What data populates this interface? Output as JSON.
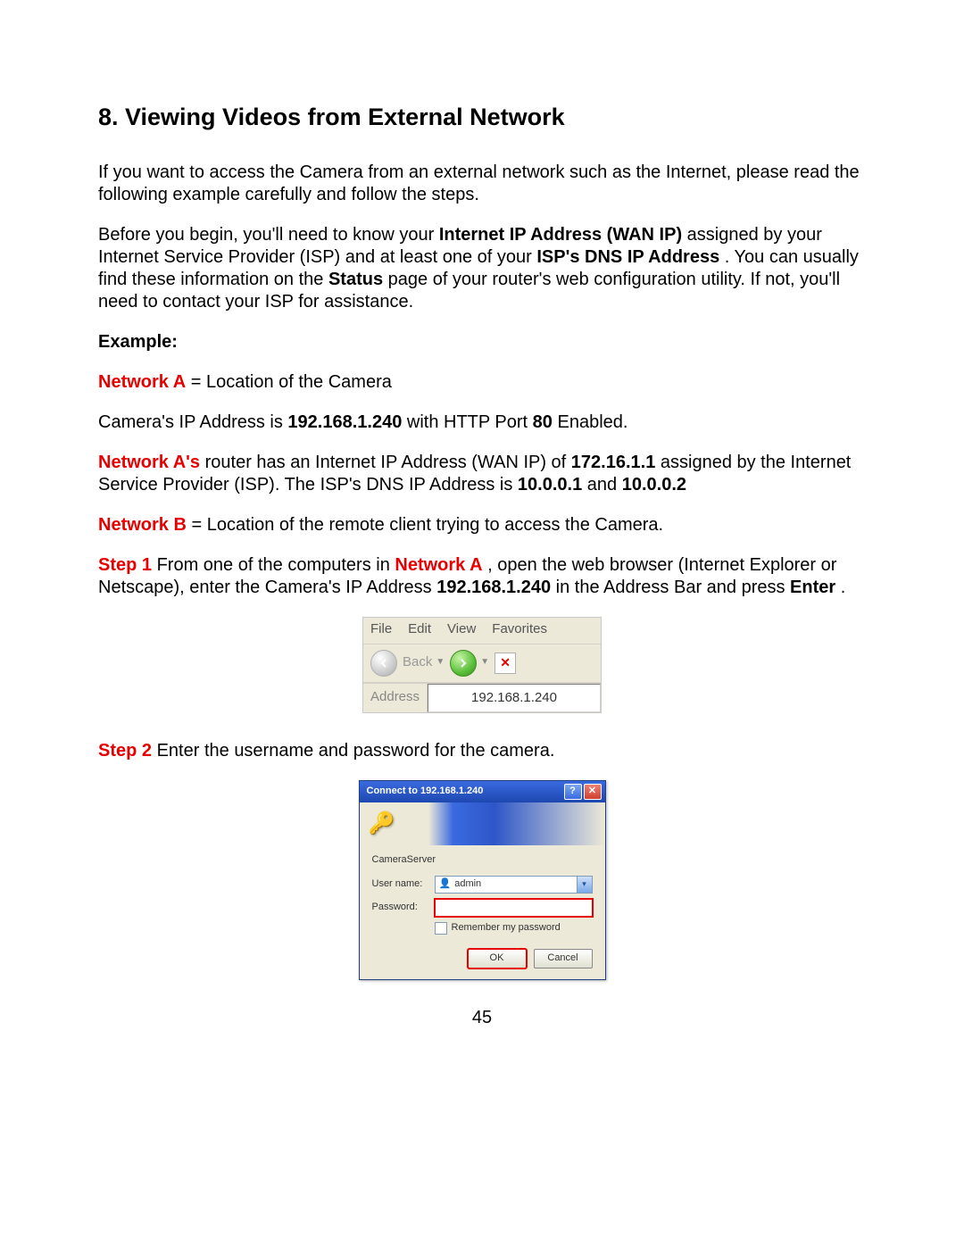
{
  "heading": "8. Viewing Videos from External Network",
  "p_intro": "If you want to access the Camera from an external network such as the Internet, please read the following example carefully and follow the steps.",
  "p_before_a": "Before you begin, you'll need to know your ",
  "p_before_b_bold": "Internet IP Address (WAN IP)",
  "p_before_c": " assigned by your Internet Service Provider (ISP) and at least one of your ",
  "p_before_d_bold": "ISP's DNS IP Address",
  "p_before_e": ". You can usually find these information on the ",
  "p_before_f_bold": "Status",
  "p_before_g": " page of your router's web configuration utility. If not, you'll need to contact your ISP for assistance.",
  "example_label": "Example:",
  "netA_a": "Network A",
  "netA_b": " = Location of the Camera",
  "camip_a": "Camera's IP Address is ",
  "camip_b_bold": "192.168.1.240",
  "camip_c": " with HTTP Port ",
  "camip_d_bold": "80",
  "camip_e": " Enabled.",
  "netArouter_a": "Network A's",
  "netArouter_b": " router has an Internet IP Address (WAN IP) of ",
  "netArouter_c_bold": "172.16.1.1",
  "netArouter_d": " assigned by the Internet Service Provider (ISP). The ISP's DNS IP Address is ",
  "netArouter_e_bold": "10.0.0.1",
  "netArouter_f": " and ",
  "netArouter_g_bold": "10.0.0.2",
  "netB_a": "Network B",
  "netB_b": " = Location of the remote client trying to access the Camera.",
  "step1_a": "Step 1",
  "step1_b": " From one of the computers in ",
  "step1_c": "Network A",
  "step1_d": ", open the web browser (Internet Explorer or Netscape), enter the Camera's IP Address ",
  "step1_e_bold": "192.168.1.240",
  "step1_f": " in the Address Bar and press ",
  "step1_g_bold": "Enter",
  "step1_h": ".",
  "browser": {
    "menu_file": "File",
    "menu_edit": "Edit",
    "menu_view": "View",
    "menu_fav": "Favorites",
    "back_label": "Back",
    "address_label": "Address",
    "address_value": "192.168.1.240"
  },
  "step2_a": "Step 2",
  "step2_b": " Enter the username and password for the camera.",
  "dialog": {
    "title": "Connect to 192.168.1.240",
    "realm": "CameraServer",
    "username_label": "User name:",
    "username_value": "admin",
    "password_label": "Password:",
    "remember_label": "Remember my password",
    "ok": "OK",
    "cancel": "Cancel"
  },
  "page_number": "45"
}
